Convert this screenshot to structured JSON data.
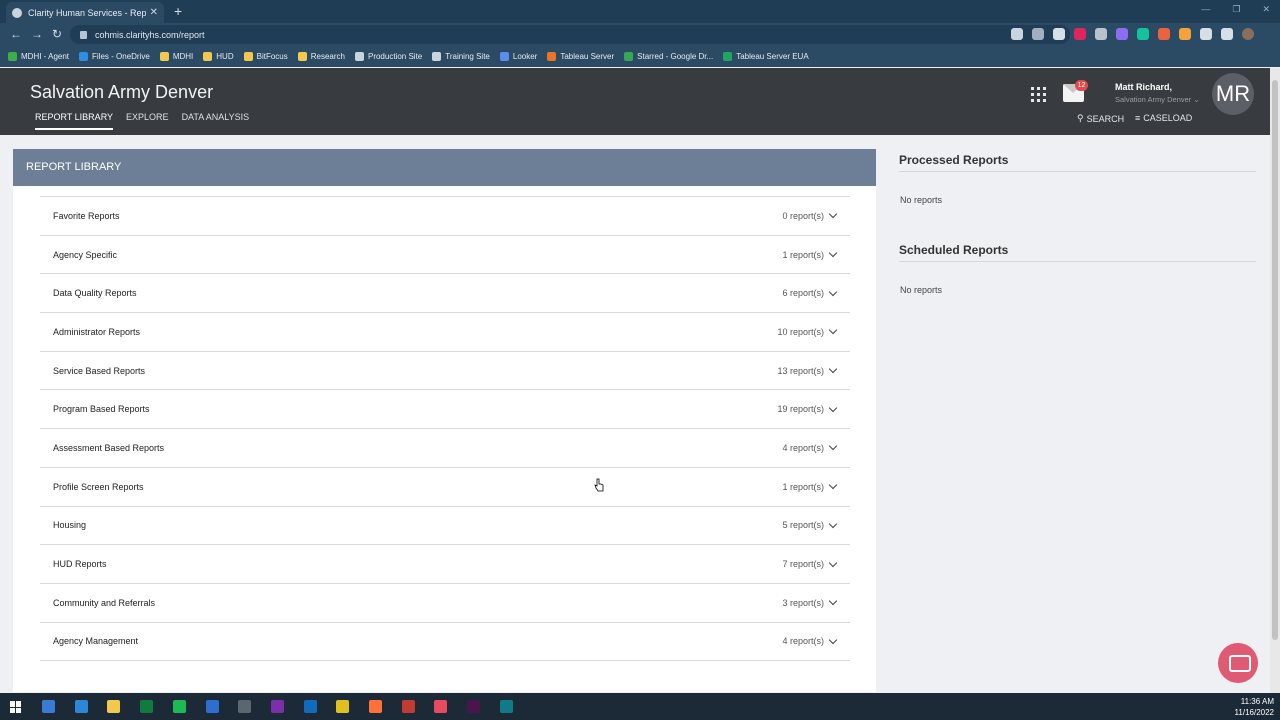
{
  "browser": {
    "tab_title": "Clarity Human Services - Report Library",
    "url": "cohmis.clarityhs.com/report",
    "bookmarks": [
      {
        "label": "MDHI - Agent",
        "color": "#3fae49"
      },
      {
        "label": "Files - OneDrive",
        "color": "#2f8de4"
      },
      {
        "label": "MDHI",
        "color": "#f2c94c"
      },
      {
        "label": "HUD",
        "color": "#f2c94c"
      },
      {
        "label": "BitFocus",
        "color": "#f2c94c"
      },
      {
        "label": "Research",
        "color": "#f2c94c"
      },
      {
        "label": "Production Site",
        "color": "#c9d4dd"
      },
      {
        "label": "Training Site",
        "color": "#c9d4dd"
      },
      {
        "label": "Looker",
        "color": "#5a8dee"
      },
      {
        "label": "Tableau Server",
        "color": "#e97627"
      },
      {
        "label": "Starred - Google Dr...",
        "color": "#34a853"
      },
      {
        "label": "Tableau Server EUA",
        "color": "#1fa463"
      }
    ]
  },
  "header": {
    "org_name": "Salvation Army Denver",
    "nav": [
      {
        "label": "REPORT LIBRARY",
        "active": true
      },
      {
        "label": "EXPLORE",
        "active": false
      },
      {
        "label": "DATA ANALYSIS",
        "active": false
      }
    ],
    "mail_count": "12",
    "user_name": "Matt Richard,",
    "user_org": "Salvation Army Denver",
    "avatar_initials": "MR",
    "search_label": "SEARCH",
    "caseload_label": "CASELOAD"
  },
  "library": {
    "title": "REPORT LIBRARY",
    "groups": [
      {
        "name": "Favorite Reports",
        "count": "0 report(s)"
      },
      {
        "name": "Agency Specific",
        "count": "1 report(s)"
      },
      {
        "name": "Data Quality Reports",
        "count": "6 report(s)"
      },
      {
        "name": "Administrator Reports",
        "count": "10 report(s)"
      },
      {
        "name": "Service Based Reports",
        "count": "13 report(s)"
      },
      {
        "name": "Program Based Reports",
        "count": "19 report(s)"
      },
      {
        "name": "Assessment Based Reports",
        "count": "4 report(s)"
      },
      {
        "name": "Profile Screen Reports",
        "count": "1 report(s)"
      },
      {
        "name": "Housing",
        "count": "5 report(s)"
      },
      {
        "name": "HUD Reports",
        "count": "7 report(s)"
      },
      {
        "name": "Community and Referrals",
        "count": "3 report(s)"
      },
      {
        "name": "Agency Management",
        "count": "4 report(s)"
      }
    ]
  },
  "sidebar": {
    "processed_title": "Processed Reports",
    "processed_empty": "No reports",
    "scheduled_title": "Scheduled Reports",
    "scheduled_empty": "No reports"
  },
  "taskbar": {
    "time": "11:36 AM",
    "date": "11/16/2022",
    "app_colors": [
      "#3a7bd5",
      "#2b88d8",
      "#f2c94c",
      "#0f7b3f",
      "#1db954",
      "#2c6fd1",
      "#5b6770",
      "#7b2fa8",
      "#0f6cbd",
      "#e0c01f",
      "#ff7139",
      "#c23b32",
      "#e84a5f",
      "#4a154b",
      "#0e7c86"
    ]
  }
}
